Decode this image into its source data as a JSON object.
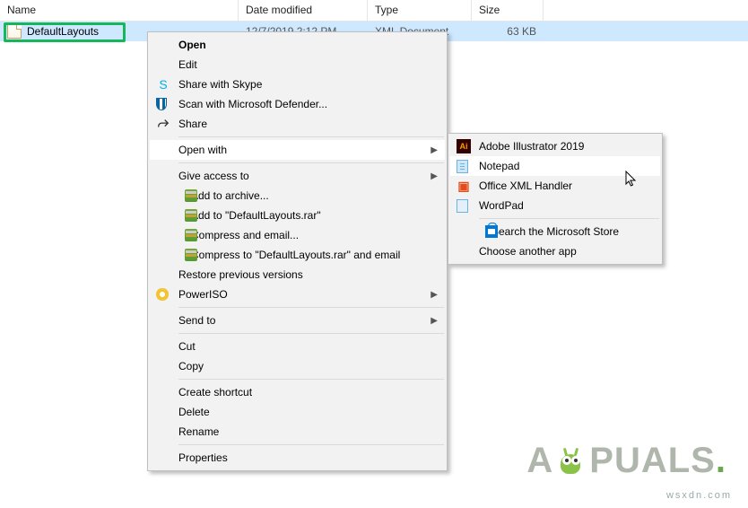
{
  "columns": {
    "name": "Name",
    "date": "Date modified",
    "type": "Type",
    "size": "Size"
  },
  "file": {
    "name": "DefaultLayouts",
    "date": "12/7/2019 2:12 PM",
    "type": "XML Document",
    "size": "63 KB"
  },
  "menu": {
    "open": "Open",
    "edit": "Edit",
    "share_skype": "Share with Skype",
    "scan_defender": "Scan with Microsoft Defender...",
    "share": "Share",
    "open_with": "Open with",
    "give_access": "Give access to",
    "add_archive": "Add to archive...",
    "add_rar": "Add to \"DefaultLayouts.rar\"",
    "compress_email": "Compress and email...",
    "compress_rar_email": "Compress to \"DefaultLayouts.rar\" and email",
    "restore_prev": "Restore previous versions",
    "poweriso": "PowerISO",
    "send_to": "Send to",
    "cut": "Cut",
    "copy": "Copy",
    "create_shortcut": "Create shortcut",
    "delete": "Delete",
    "rename": "Rename",
    "properties": "Properties"
  },
  "submenu": {
    "illustrator": "Adobe Illustrator 2019",
    "notepad": "Notepad",
    "xml_handler": "Office XML Handler",
    "wordpad": "WordPad",
    "search_store": "Search the Microsoft Store",
    "choose_another": "Choose another app"
  },
  "watermark": {
    "brand_left": "A",
    "brand_right": "PUALS",
    "dot": ".",
    "site": "wsxdn.com"
  }
}
